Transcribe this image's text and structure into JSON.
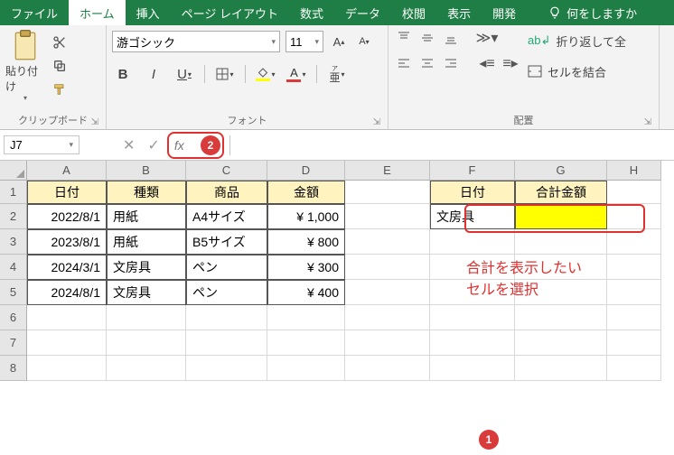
{
  "tabs": {
    "file": "ファイル",
    "home": "ホーム",
    "insert": "挿入",
    "layout": "ページ レイアウト",
    "formulas": "数式",
    "data": "データ",
    "review": "校閲",
    "view": "表示",
    "dev": "開発",
    "tellme": "何をしますか"
  },
  "clip": {
    "paste": "貼り付け",
    "label": "クリップボード"
  },
  "font": {
    "name": "游ゴシック",
    "size": "11",
    "bold": "B",
    "italic": "I",
    "underline": "U",
    "ruby_label": "ア",
    "ruby_small": "亜",
    "label": "フォント"
  },
  "align": {
    "wrap": "折り返して全",
    "merge": "セルを結合",
    "label": "配置"
  },
  "namebox": "J7",
  "fx": "fx",
  "badge1": "1",
  "badge2": "2",
  "cols": [
    "A",
    "B",
    "C",
    "D",
    "E",
    "F",
    "G",
    "H"
  ],
  "rows": [
    "1",
    "2",
    "3",
    "4",
    "5",
    "6",
    "7",
    "8"
  ],
  "table1": {
    "headers": {
      "a": "日付",
      "b": "種類",
      "c": "商品",
      "d": "金額"
    },
    "rows": [
      {
        "a": "2022/8/1",
        "b": "用紙",
        "c": "A4サイズ",
        "d": "¥   1,000"
      },
      {
        "a": "2023/8/1",
        "b": "用紙",
        "c": "B5サイズ",
        "d": "¥      800"
      },
      {
        "a": "2024/3/1",
        "b": "文房具",
        "c": "ペン",
        "d": "¥      300"
      },
      {
        "a": "2024/8/1",
        "b": "文房具",
        "c": "ペン",
        "d": "¥      400"
      }
    ]
  },
  "table2": {
    "headers": {
      "f": "日付",
      "g": "合計金額"
    },
    "row": {
      "f": "文房具"
    }
  },
  "annotation": "合計を表示したい<br>セルを選択"
}
